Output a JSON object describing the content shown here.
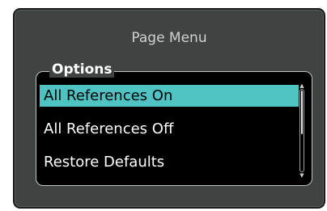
{
  "menu": {
    "title": "Page Menu",
    "options_label": "Options",
    "items": [
      {
        "label": "All References On",
        "selected": true
      },
      {
        "label": "All References Off",
        "selected": false
      },
      {
        "label": "Restore Defaults",
        "selected": false
      }
    ],
    "scroll": {
      "position_fraction": 0.0,
      "visible_fraction": 0.55
    }
  },
  "colors": {
    "panel_background": "#3f4442",
    "list_background": "#000000",
    "selection_highlight": "#4ec3c2",
    "title_text": "#d0d2d1",
    "item_text": "#ffffff"
  }
}
